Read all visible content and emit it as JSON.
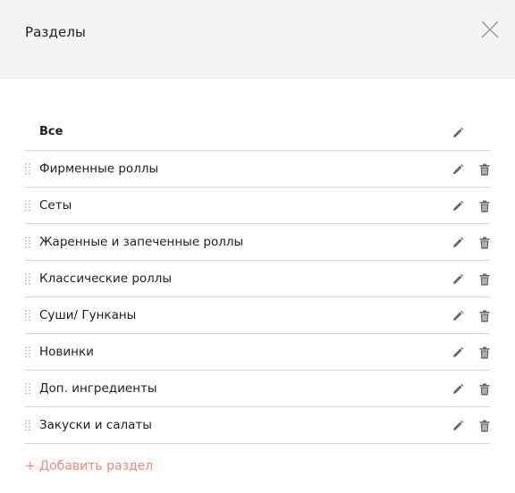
{
  "header": {
    "title": "Разделы",
    "close_icon": "close-icon"
  },
  "sections": {
    "all_label": "Все",
    "items": [
      {
        "label": "Фирменные роллы"
      },
      {
        "label": "Сеты"
      },
      {
        "label": "Жаренные и запеченные роллы"
      },
      {
        "label": "Классические роллы"
      },
      {
        "label": "Суши/ Гунканы"
      },
      {
        "label": "Новинки"
      },
      {
        "label": "Доп. ингредиенты"
      },
      {
        "label": "Закуски и салаты"
      }
    ]
  },
  "add_section_label": "+ Добавить раздел",
  "colors": {
    "header_bg": "#f4f4f4",
    "accent": "#f08a7e",
    "divider": "#d6d6d6",
    "icon": "#666666"
  }
}
